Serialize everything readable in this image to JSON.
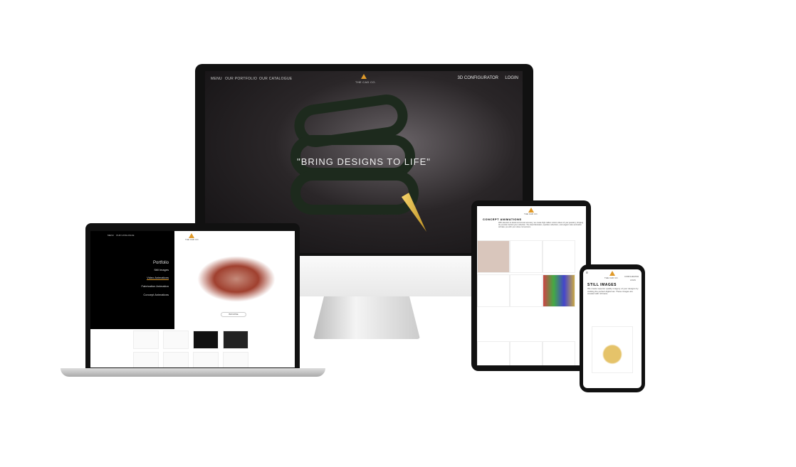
{
  "desktop": {
    "nav_left": [
      "MENU",
      "OUR PORTFOLIO",
      "OUR CATALOGUE"
    ],
    "brand": "THE CAD CO.",
    "nav_right": [
      "3D CONFIGURATOR",
      "LOGIN"
    ],
    "hero": "\"BRING DESIGNS TO LIFE\""
  },
  "laptop": {
    "top_nav": [
      "MENU",
      "OUR CATALOGUE"
    ],
    "brand": "THE CAD CO.",
    "section": "Portfolio",
    "items": [
      "Still Images",
      "Video Animations",
      "Fabrication Animation",
      "Concept Animations"
    ],
    "button": "BROWSE"
  },
  "tablet": {
    "brand": "THE CAD CO.",
    "heading": "CONCEPT ANIMATIONS",
    "body": "With attention to detail and utmost accuracy, we create high caliber motion videos of your jewellery, bringing the emotion behind your collection. The ideal illustration, sparkles reflections, and elegant video animation will take you with your value conversions."
  },
  "phone": {
    "brand": "THE CAD CO.",
    "menu": [
      "CONFIGURATOR",
      "LOGIN"
    ],
    "heading": "STILL IMAGES",
    "body": "We create superior quality imagery of your designs by crafting the perfect digital set. These images are created with richness."
  },
  "colors": {
    "accent": "#e09a2a"
  }
}
